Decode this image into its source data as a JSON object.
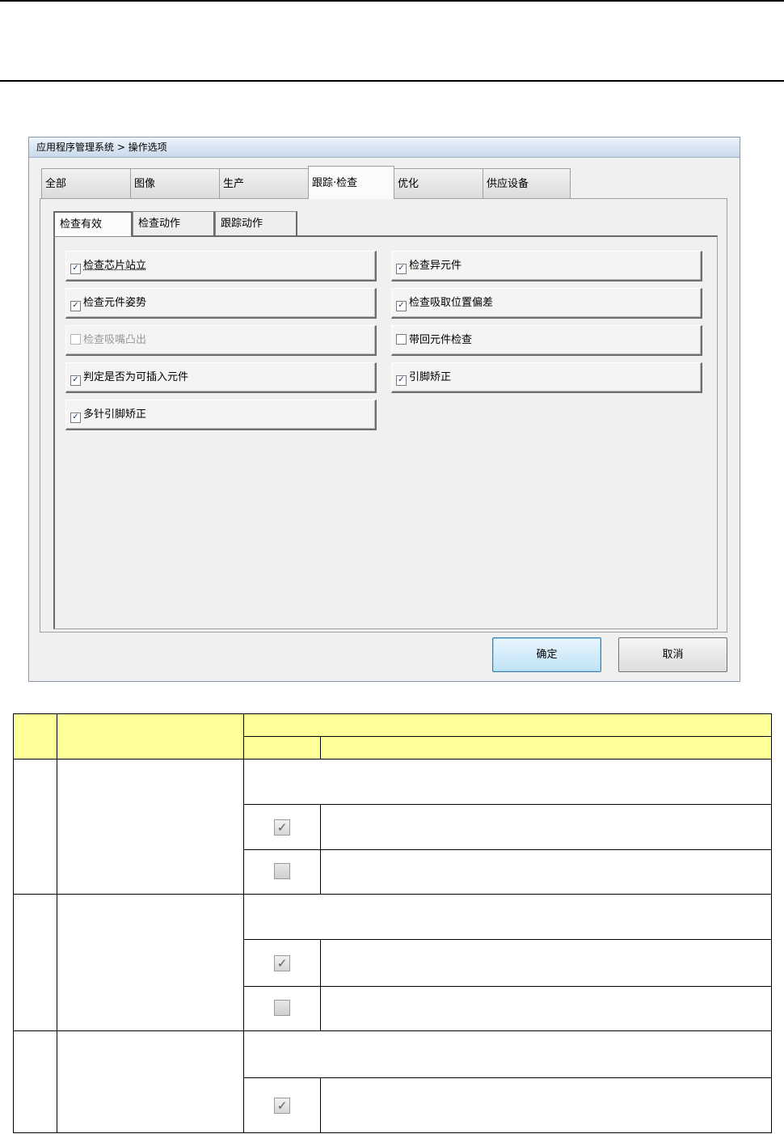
{
  "dialog": {
    "breadcrumb": "应用程序管理系统 > 操作选项",
    "tabs": [
      {
        "label": "全部",
        "active": false
      },
      {
        "label": "图像",
        "active": false
      },
      {
        "label": "生产",
        "active": false
      },
      {
        "label": "跟踪·检查",
        "active": true
      },
      {
        "label": "优化",
        "active": false
      },
      {
        "label": "供应设备",
        "active": false
      }
    ],
    "subtabs": [
      {
        "label": "检查有效",
        "active": true
      },
      {
        "label": "检查动作",
        "active": false
      },
      {
        "label": "跟踪动作",
        "active": false
      }
    ],
    "options_left": [
      {
        "label": "检查芯片站立",
        "checked": true,
        "enabled": true
      },
      {
        "label": "检查元件姿势",
        "checked": true,
        "enabled": true
      },
      {
        "label": "检查吸嘴凸出",
        "checked": false,
        "enabled": false
      },
      {
        "label": "判定是否为可插入元件",
        "checked": true,
        "enabled": true
      },
      {
        "label": "多针引脚矫正",
        "checked": true,
        "enabled": true
      }
    ],
    "options_right": [
      {
        "label": "检查异元件",
        "checked": true,
        "enabled": true
      },
      {
        "label": "检查吸取位置偏差",
        "checked": true,
        "enabled": true
      },
      {
        "label": "带回元件检查",
        "checked": false,
        "enabled": true
      },
      {
        "label": "引脚矫正",
        "checked": true,
        "enabled": true
      }
    ],
    "ok_label": "确定",
    "cancel_label": "取消",
    "checkmark_glyph": "✓",
    "cell_checkmark_glyph": "☑"
  },
  "table": {
    "colors": {
      "header_bg": "#ffff99"
    },
    "row_states": [
      "checked",
      "unchecked",
      "checked",
      "unchecked",
      "checked"
    ]
  }
}
